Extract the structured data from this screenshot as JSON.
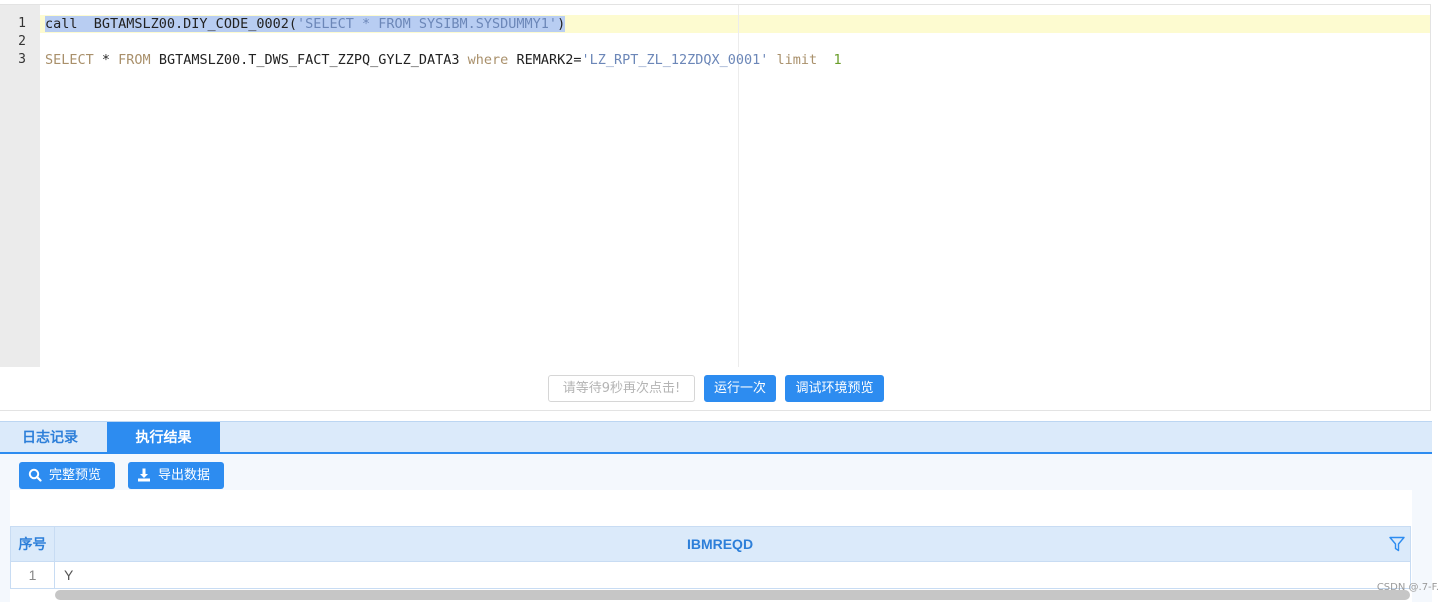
{
  "editor": {
    "line_numbers": [
      "1",
      "2",
      "3"
    ],
    "line1": {
      "kw": "call",
      "ident": "  BGTAMSLZ00.DIY_CODE_0002(",
      "str": "'SELECT * FROM SYSIBM.SYSDUMMY1'",
      "close": ")"
    },
    "line3": {
      "kw1": "SELECT",
      "t1": " * ",
      "kw2": "FROM",
      "t2": " BGTAMSLZ00.T_DWS_FACT_ZZPQ_GYLZ_DATA3 ",
      "kw3": "where",
      "t3": " REMARK2=",
      "str": "'LZ_RPT_ZL_12ZDQX_0001'",
      "kw4": " limit",
      "t4": "  ",
      "num": "1"
    }
  },
  "actions": {
    "wait_label": "请等待9秒再次点击!",
    "run_label": "运行一次",
    "preview_label": "调试环境预览"
  },
  "tabs": {
    "log_label": "日志记录",
    "result_label": "执行结果"
  },
  "toolbar": {
    "full_preview_label": "完整预览",
    "export_label": "导出数据"
  },
  "result_table": {
    "headers": [
      "序号",
      "IBMREQD"
    ],
    "rows": [
      {
        "index": "1",
        "value": "Y"
      }
    ]
  },
  "watermark": "CSDN @.7-F.",
  "colors": {
    "accent": "#2d8cf0",
    "tab_bg": "#dbeafa",
    "current_line": "#fdfbd0",
    "selection": "#b8cdf2"
  }
}
